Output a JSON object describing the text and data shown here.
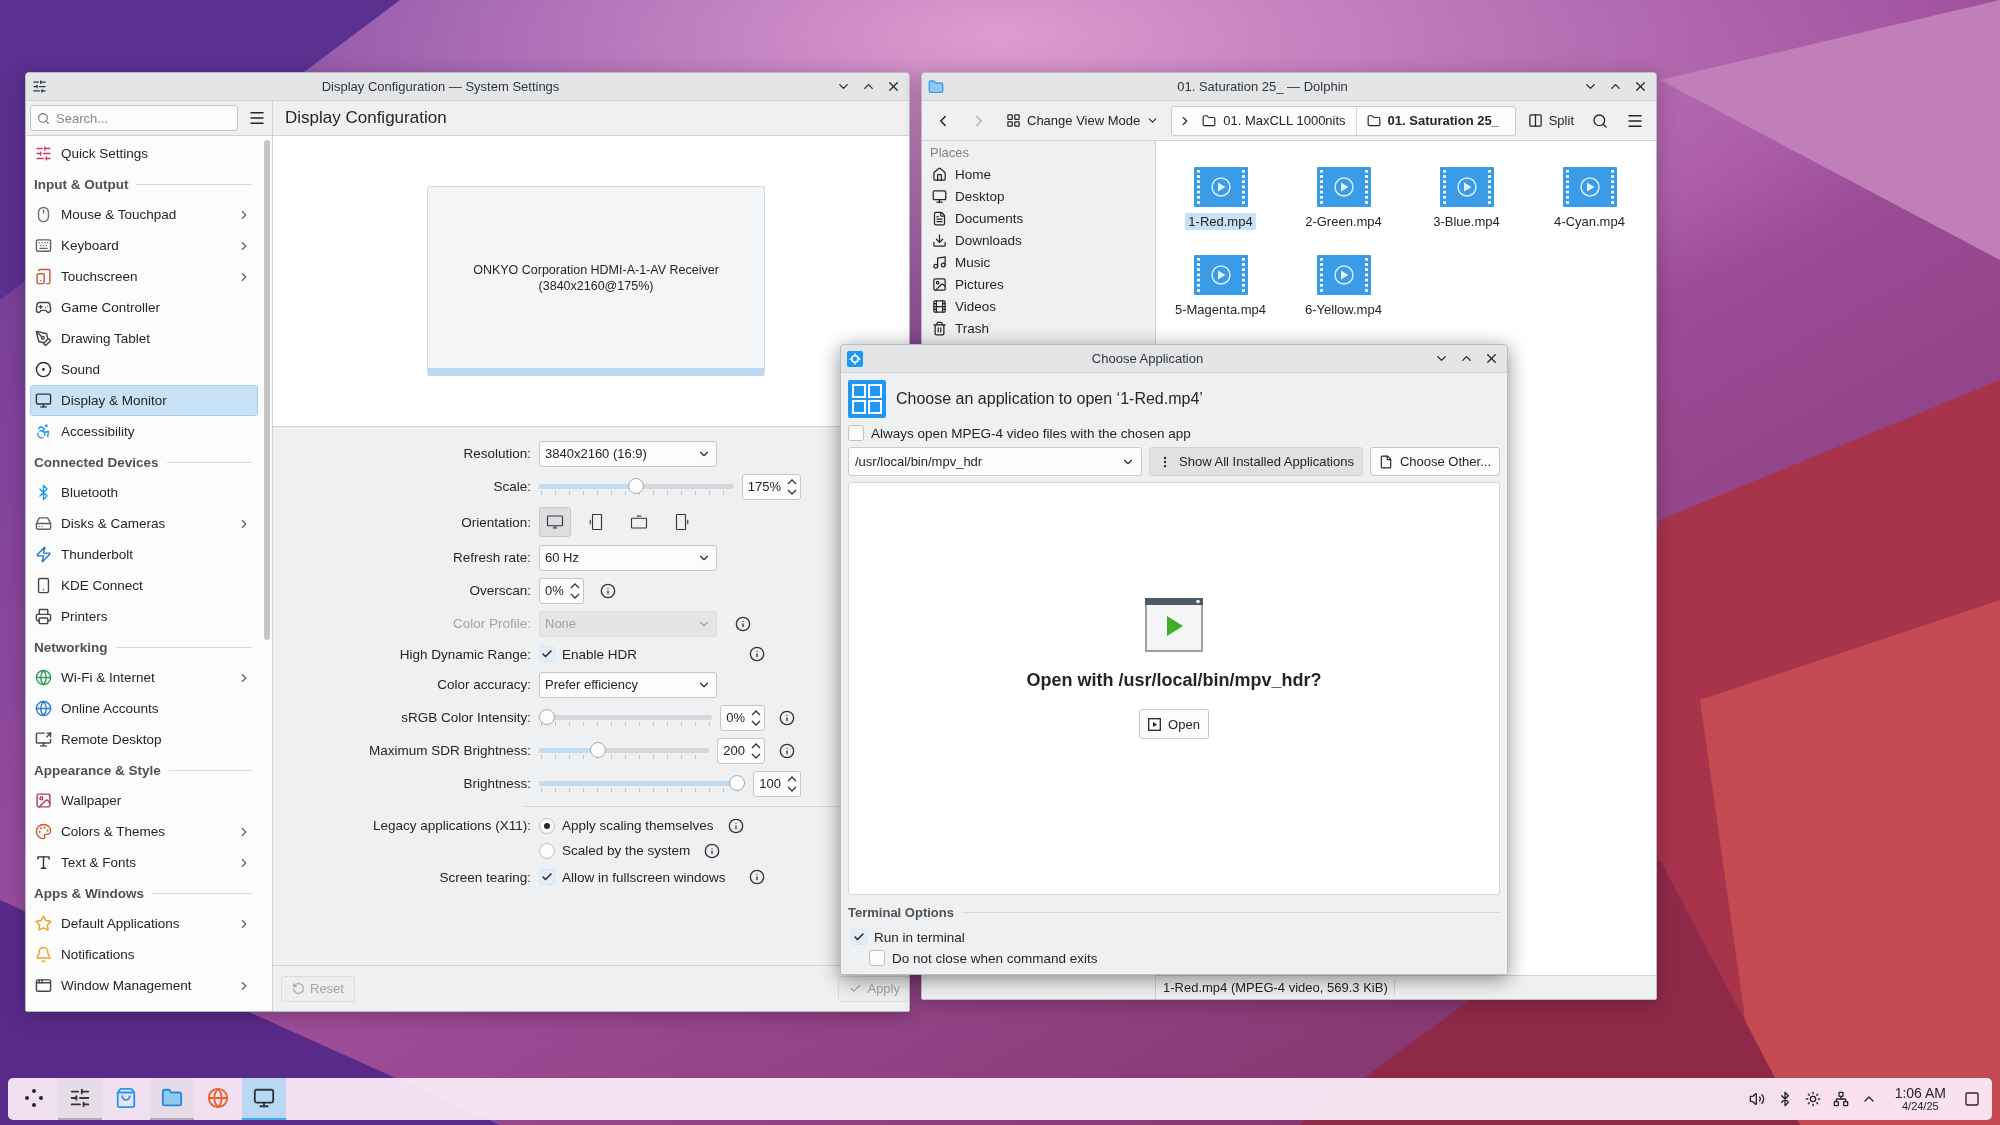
{
  "settings_window": {
    "title": "Display Configuration — System Settings",
    "page_title": "Display Configuration",
    "sidebar": {
      "search_placeholder": "Search...",
      "items": [
        {
          "kind": "item",
          "label": "Quick Settings",
          "chevron": false,
          "selected": false
        },
        {
          "kind": "header",
          "label": "Input & Output"
        },
        {
          "kind": "item",
          "label": "Mouse & Touchpad",
          "chevron": true,
          "selected": false
        },
        {
          "kind": "item",
          "label": "Keyboard",
          "chevron": true,
          "selected": false
        },
        {
          "kind": "item",
          "label": "Touchscreen",
          "chevron": true,
          "selected": false
        },
        {
          "kind": "item",
          "label": "Game Controller",
          "chevron": false,
          "selected": false
        },
        {
          "kind": "item",
          "label": "Drawing Tablet",
          "chevron": false,
          "selected": false
        },
        {
          "kind": "item",
          "label": "Sound",
          "chevron": false,
          "selected": false
        },
        {
          "kind": "item",
          "label": "Display & Monitor",
          "chevron": false,
          "selected": true
        },
        {
          "kind": "item",
          "label": "Accessibility",
          "chevron": false,
          "selected": false
        },
        {
          "kind": "header",
          "label": "Connected Devices"
        },
        {
          "kind": "item",
          "label": "Bluetooth",
          "chevron": false,
          "selected": false
        },
        {
          "kind": "item",
          "label": "Disks & Cameras",
          "chevron": true,
          "selected": false
        },
        {
          "kind": "item",
          "label": "Thunderbolt",
          "chevron": false,
          "selected": false
        },
        {
          "kind": "item",
          "label": "KDE Connect",
          "chevron": false,
          "selected": false
        },
        {
          "kind": "item",
          "label": "Printers",
          "chevron": false,
          "selected": false
        },
        {
          "kind": "header",
          "label": "Networking"
        },
        {
          "kind": "item",
          "label": "Wi-Fi & Internet",
          "chevron": true,
          "selected": false
        },
        {
          "kind": "item",
          "label": "Online Accounts",
          "chevron": false,
          "selected": false
        },
        {
          "kind": "item",
          "label": "Remote Desktop",
          "chevron": false,
          "selected": false
        },
        {
          "kind": "header",
          "label": "Appearance & Style"
        },
        {
          "kind": "item",
          "label": "Wallpaper",
          "chevron": false,
          "selected": false
        },
        {
          "kind": "item",
          "label": "Colors & Themes",
          "chevron": true,
          "selected": false
        },
        {
          "kind": "item",
          "label": "Text & Fonts",
          "chevron": true,
          "selected": false
        },
        {
          "kind": "header",
          "label": "Apps & Windows"
        },
        {
          "kind": "item",
          "label": "Default Applications",
          "chevron": true,
          "selected": false
        },
        {
          "kind": "item",
          "label": "Notifications",
          "chevron": false,
          "selected": false
        },
        {
          "kind": "item",
          "label": "Window Management",
          "chevron": true,
          "selected": false
        }
      ]
    },
    "monitor": {
      "name": "ONKYO Corporation HDMI-A-1-AV Receiver",
      "mode": "(3840x2160@175%)"
    },
    "form": [
      {
        "kind": "dropdown",
        "label": "Resolution:",
        "value": "3840x2160 (16:9)",
        "disabled": false,
        "info": false
      },
      {
        "kind": "slider",
        "label": "Scale:",
        "level": 0.5,
        "value": "175%",
        "info": false
      },
      {
        "kind": "orientation",
        "label": "Orientation:",
        "options": [
          {
            "selected": true
          },
          {
            "selected": false
          },
          {
            "selected": false
          },
          {
            "selected": false
          }
        ]
      },
      {
        "kind": "dropdown",
        "label": "Refresh rate:",
        "value": "60 Hz",
        "disabled": false,
        "info": false
      },
      {
        "kind": "spin",
        "label": "Overscan:",
        "value": "0%",
        "info": true
      },
      {
        "kind": "dropdown",
        "label": "Color Profile:",
        "value": "None",
        "disabled": true,
        "info": true
      },
      {
        "kind": "checkbox",
        "label": "High Dynamic Range:",
        "text": "Enable HDR",
        "checked": true,
        "info": true
      },
      {
        "kind": "dropdown",
        "label": "Color accuracy:",
        "value": "Prefer efficiency",
        "disabled": false,
        "info": false
      },
      {
        "kind": "slider",
        "label": "sRGB Color Intensity:",
        "level": 0,
        "value": "0%",
        "info": true
      },
      {
        "kind": "slider",
        "label": "Maximum SDR Brightness:",
        "level": 0.33,
        "value": "200",
        "info": true
      },
      {
        "kind": "slider",
        "label": "Brightness:",
        "level": 1,
        "value": "100",
        "info": false
      },
      {
        "kind": "separator"
      },
      {
        "kind": "radio",
        "label": "Legacy applications (X11):",
        "text": "Apply scaling themselves",
        "selected": true,
        "info": true
      },
      {
        "kind": "radio",
        "text": "Scaled by the system",
        "selected": false,
        "info": true
      },
      {
        "kind": "checkbox",
        "label": "Screen tearing:",
        "text": "Allow in fullscreen windows",
        "checked": true,
        "info": true
      }
    ],
    "footer": {
      "reset": {
        "label": "Reset",
        "disabled": true
      },
      "apply": {
        "label": "Apply",
        "disabled": true
      }
    }
  },
  "dolphin": {
    "title": "01. Saturation 25_ — Dolphin",
    "view_mode": "Change View Mode",
    "breadcrumb": [
      {
        "label": "01. MaxCLL 1000nits",
        "current": false
      },
      {
        "label": "01. Saturation 25_",
        "current": true
      }
    ],
    "split": "Split",
    "places_header": "Places",
    "places": [
      {
        "label": "Home",
        "selected": false
      },
      {
        "label": "Desktop",
        "selected": false
      },
      {
        "label": "Documents",
        "selected": false
      },
      {
        "label": "Downloads",
        "selected": false
      },
      {
        "label": "Music",
        "selected": false
      },
      {
        "label": "Pictures",
        "selected": false
      },
      {
        "label": "Videos",
        "selected": false
      },
      {
        "label": "Trash",
        "selected": false
      }
    ],
    "files": [
      {
        "name": "1-Red.mp4",
        "selected": true
      },
      {
        "name": "2-Green.mp4",
        "selected": false
      },
      {
        "name": "3-Blue.mp4",
        "selected": false
      },
      {
        "name": "4-Cyan.mp4",
        "selected": false
      },
      {
        "name": "5-Magenta.mp4",
        "selected": false
      },
      {
        "name": "6-Yellow.mp4",
        "selected": false
      }
    ],
    "status": "1-Red.mp4 (MPEG-4 video, 569.3 KiB)"
  },
  "dialog": {
    "title": "Choose Application",
    "heading": "Choose an application to open ‘1-Red.mp4’",
    "always_open": {
      "label": "Always open MPEG-4 video files with the chosen app",
      "checked": false
    },
    "app_path": "/usr/local/bin/mpv_hdr",
    "show_all": {
      "label": "Show All Installed Applications",
      "pressed": true
    },
    "choose_other": "Choose Other...",
    "prompt": "Open with /usr/local/bin/mpv_hdr?",
    "open": "Open",
    "terminal_header": "Terminal Options",
    "terminal_options": [
      {
        "label": "Run in terminal",
        "checked": true,
        "children": [
          {
            "label": "Do not close when command exits",
            "checked": false
          }
        ]
      }
    ]
  },
  "taskbar": {
    "tasks": [
      {
        "open": true,
        "selected": false
      },
      {
        "open": false,
        "selected": false
      },
      {
        "open": true,
        "selected": false
      },
      {
        "open": false,
        "selected": false
      },
      {
        "open": true,
        "selected": true
      }
    ],
    "time": "1:06 AM",
    "date": "4/24/25"
  }
}
